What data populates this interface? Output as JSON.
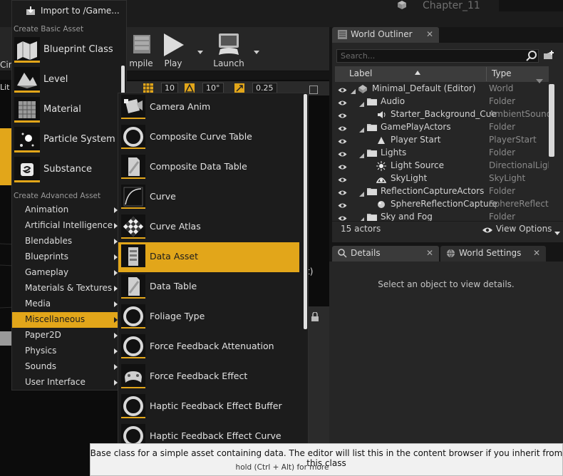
{
  "window": {
    "title": "Chapter_11"
  },
  "toolbar": {
    "buttons": [
      {
        "label": "Cin"
      },
      {
        "label": "mpile"
      },
      {
        "label": "Play"
      },
      {
        "label": "Launch"
      }
    ]
  },
  "viewport": {
    "snap_chips": [
      "10",
      "10°",
      "0.25"
    ],
    "left_label": "Lit",
    "paren": "t)"
  },
  "outliner": {
    "tab_label": "World Outliner",
    "search_placeholder": "Search...",
    "columns": {
      "label": "Label",
      "type": "Type"
    },
    "rows": [
      {
        "name": "Minimal_Default (Editor)",
        "type": "World",
        "indent": 0,
        "icon": "world-icon"
      },
      {
        "name": "Audio",
        "type": "Folder",
        "indent": 1,
        "icon": "folder-icon"
      },
      {
        "name": "Starter_Background_Cue",
        "type": "AmbientSound",
        "indent": 2,
        "icon": "sound-icon"
      },
      {
        "name": "GamePlayActors",
        "type": "Folder",
        "indent": 1,
        "icon": "folder-icon"
      },
      {
        "name": "Player Start",
        "type": "PlayerStart",
        "indent": 2,
        "icon": "player-start-icon"
      },
      {
        "name": "Lights",
        "type": "Folder",
        "indent": 1,
        "icon": "folder-icon"
      },
      {
        "name": "Light Source",
        "type": "DirectionalLight",
        "indent": 2,
        "icon": "light-icon"
      },
      {
        "name": "SkyLight",
        "type": "SkyLight",
        "indent": 2,
        "icon": "skylight-icon"
      },
      {
        "name": "ReflectionCaptureActors",
        "type": "Folder",
        "indent": 1,
        "icon": "folder-icon"
      },
      {
        "name": "SphereReflectionCapture",
        "type": "SphereReflectionCapture",
        "indent": 2,
        "icon": "reflection-icon"
      },
      {
        "name": "Sky and Fog",
        "type": "Folder",
        "indent": 1,
        "icon": "folder-icon"
      }
    ],
    "actor_count": "15 actors",
    "view_options": "View Options"
  },
  "details": {
    "tab_label": "Details",
    "world_settings_label": "World Settings",
    "empty_message": "Select an object to view details."
  },
  "menu": {
    "import_label": "Import to /Game...",
    "basic_header": "Create Basic Asset",
    "basic_items": [
      {
        "label": "Blueprint Class",
        "icon": "blueprint-class-icon"
      },
      {
        "label": "Level",
        "icon": "level-icon"
      },
      {
        "label": "Material",
        "icon": "material-icon"
      },
      {
        "label": "Particle System",
        "icon": "particle-system-icon"
      },
      {
        "label": "Substance",
        "icon": "substance-icon"
      }
    ],
    "advanced_header": "Create Advanced Asset",
    "advanced_items": [
      "Animation",
      "Artificial Intelligence",
      "Blendables",
      "Blueprints",
      "Gameplay",
      "Materials & Textures",
      "Media",
      "Miscellaneous",
      "Paper2D",
      "Physics",
      "Sounds",
      "User Interface"
    ],
    "selected_advanced": "Miscellaneous"
  },
  "submenu": {
    "items": [
      {
        "label": "Camera Anim",
        "icon": "camera-anim-icon"
      },
      {
        "label": "Composite Curve Table",
        "icon": "ring-icon"
      },
      {
        "label": "Composite Data Table",
        "icon": "document-icon"
      },
      {
        "label": "Curve",
        "icon": "curve-icon"
      },
      {
        "label": "Curve Atlas",
        "icon": "checker-icon"
      },
      {
        "label": "Data Asset",
        "icon": "data-asset-icon"
      },
      {
        "label": "Data Table",
        "icon": "document-icon"
      },
      {
        "label": "Foliage Type",
        "icon": "ring-icon"
      },
      {
        "label": "Force Feedback Attenuation",
        "icon": "ring-icon"
      },
      {
        "label": "Force Feedback Effect",
        "icon": "gamepad-icon"
      },
      {
        "label": "Haptic Feedback Effect Buffer",
        "icon": "ring-icon"
      },
      {
        "label": "Haptic Feedback Effect Curve",
        "icon": "ring-icon"
      }
    ],
    "selected": "Data Asset"
  },
  "tooltip": {
    "text": "Base class for a simple asset containing data. The editor will list this in the content browser if you inherit from this class",
    "hint": "hold (Ctrl + Alt) for more"
  },
  "colors": {
    "accent": "#e2a61a",
    "menu_bg": "#1c1c1c",
    "panel_bg": "#262626",
    "tooltip_bg": "#f1f1f1"
  }
}
